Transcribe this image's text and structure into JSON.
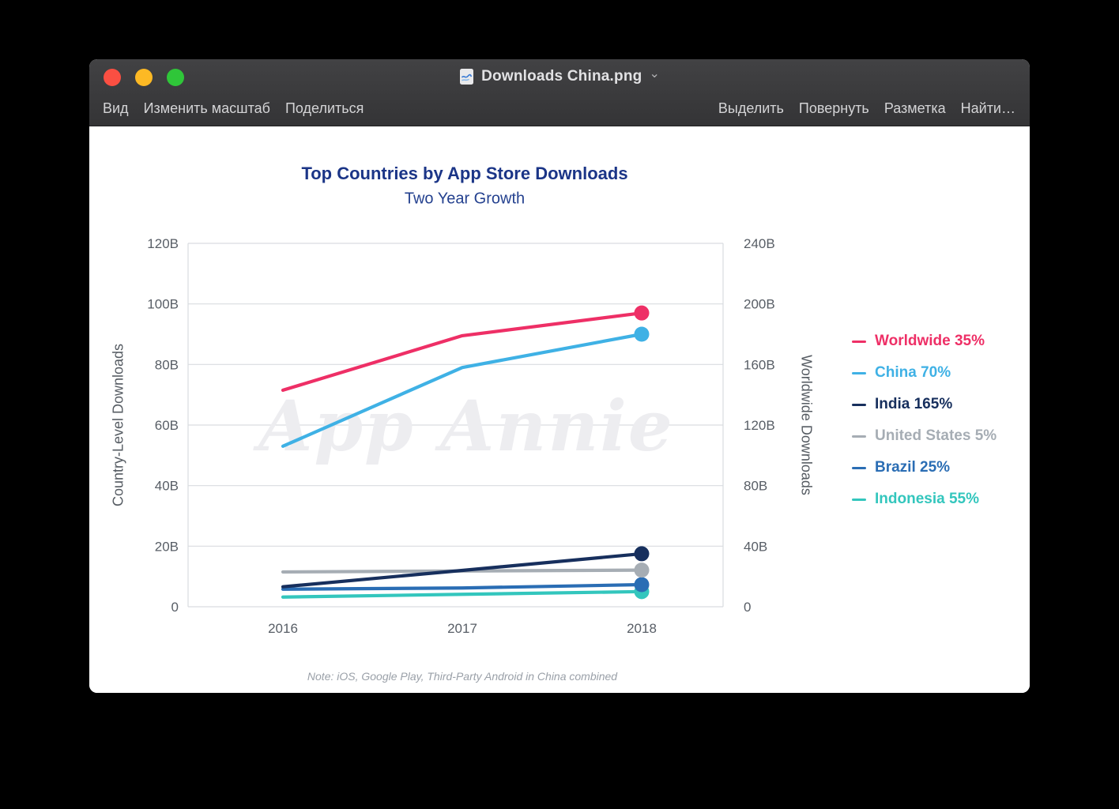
{
  "window": {
    "title": "Downloads China.png",
    "menu_left": [
      "Вид",
      "Изменить масштаб",
      "Поделиться"
    ],
    "menu_right": [
      "Выделить",
      "Повернуть",
      "Разметка",
      "Найти…"
    ]
  },
  "chart_data": {
    "type": "line",
    "title": "Top Countries by App Store Downloads",
    "subtitle": "Two Year Growth",
    "x_labels": [
      "2016",
      "2017",
      "2018"
    ],
    "left_axis": {
      "label": "Country-Level Downloads",
      "range": [
        0,
        120
      ],
      "ticks": [
        "0",
        "20B",
        "40B",
        "60B",
        "80B",
        "100B",
        "120B"
      ]
    },
    "right_axis": {
      "label": "Worldwide Downloads",
      "range": [
        0,
        240
      ],
      "ticks": [
        "0",
        "40B",
        "80B",
        "120B",
        "160B",
        "200B",
        "240B"
      ]
    },
    "grid": true,
    "legend_position": "right",
    "watermark": "App Annie",
    "note": "Note: iOS, Google Play, Third-Party Android in China combined",
    "series": [
      {
        "name": "Worldwide 35%",
        "color": "#ee2f66",
        "axis": "right",
        "values": [
          143,
          179,
          194
        ]
      },
      {
        "name": "China 70%",
        "color": "#3fb1e5",
        "axis": "left",
        "values": [
          53,
          79,
          90
        ]
      },
      {
        "name": "India 165%",
        "color": "#172f5d",
        "axis": "left",
        "values": [
          6.6,
          12,
          17.5
        ]
      },
      {
        "name": "United States 5%",
        "color": "#a6adb4",
        "axis": "left",
        "values": [
          11.5,
          11.8,
          12.1
        ]
      },
      {
        "name": "Brazil 25%",
        "color": "#2a6db4",
        "axis": "left",
        "values": [
          5.8,
          6.2,
          7.3
        ]
      },
      {
        "name": "Indonesia 55%",
        "color": "#33c6bd",
        "axis": "left",
        "values": [
          3.2,
          4.1,
          5
        ]
      }
    ]
  }
}
